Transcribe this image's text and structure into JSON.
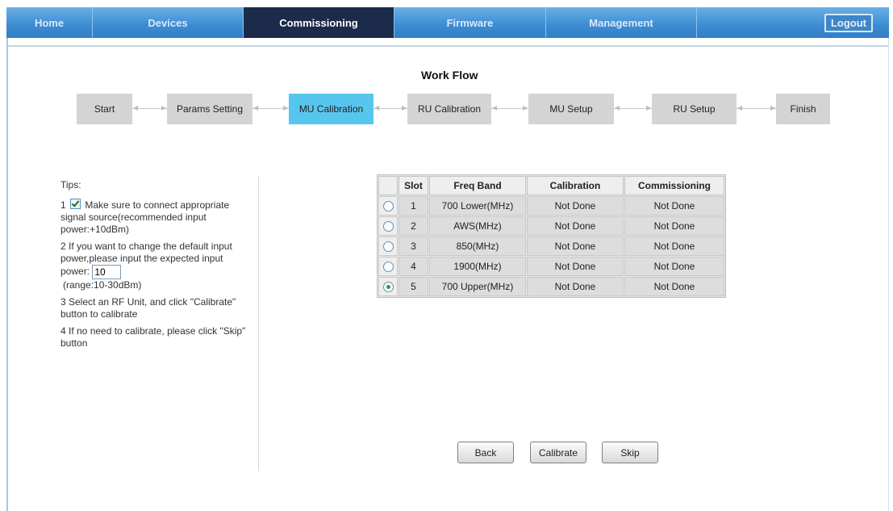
{
  "nav": {
    "tabs": [
      {
        "label": "Home"
      },
      {
        "label": "Devices"
      },
      {
        "label": "Commissioning"
      },
      {
        "label": "Firmware"
      },
      {
        "label": "Management"
      },
      {
        "label": ""
      }
    ],
    "active_tab": "Commissioning",
    "logout_label": "Logout"
  },
  "workflow": {
    "title": "Work Flow",
    "steps": [
      "Start",
      "Params Setting",
      "MU Calibration",
      "RU Calibration",
      "MU Setup",
      "RU Setup",
      "Finish"
    ],
    "active_step": "MU Calibration"
  },
  "tips": {
    "heading": "Tips:",
    "tip1_num": "1",
    "tip1_text": "Make sure to connect appropriate signal source(recommended input power:+10dBm)",
    "tip1_checked": true,
    "tip2_text": "2 If you want to change the default input power,please input the expected input power:",
    "tip2_value": "10",
    "tip2_range": "(range:10-30dBm)",
    "tip3_text": "3 Select an RF Unit, and click \"Calibrate\" button to calibrate",
    "tip4_text": "4 If no need to calibrate, please click \"Skip\" button"
  },
  "table": {
    "headers": [
      "",
      "Slot",
      "Freq Band",
      "Calibration",
      "Commissioning"
    ],
    "rows": [
      {
        "slot": "1",
        "band": "700 Lower(MHz)",
        "calibration": "Not Done",
        "commissioning": "Not Done",
        "selected": false
      },
      {
        "slot": "2",
        "band": "AWS(MHz)",
        "calibration": "Not Done",
        "commissioning": "Not Done",
        "selected": false
      },
      {
        "slot": "3",
        "band": "850(MHz)",
        "calibration": "Not Done",
        "commissioning": "Not Done",
        "selected": false
      },
      {
        "slot": "4",
        "band": "1900(MHz)",
        "calibration": "Not Done",
        "commissioning": "Not Done",
        "selected": false
      },
      {
        "slot": "5",
        "band": "700 Upper(MHz)",
        "calibration": "Not Done",
        "commissioning": "Not Done",
        "selected": true
      }
    ]
  },
  "buttons": {
    "back": "Back",
    "calibrate": "Calibrate",
    "skip": "Skip"
  },
  "colors": {
    "nav_bar": "#3f8ed4",
    "nav_active": "#1d2b4a",
    "step_active": "#57c6ee",
    "step_default": "#d4d4d4"
  }
}
